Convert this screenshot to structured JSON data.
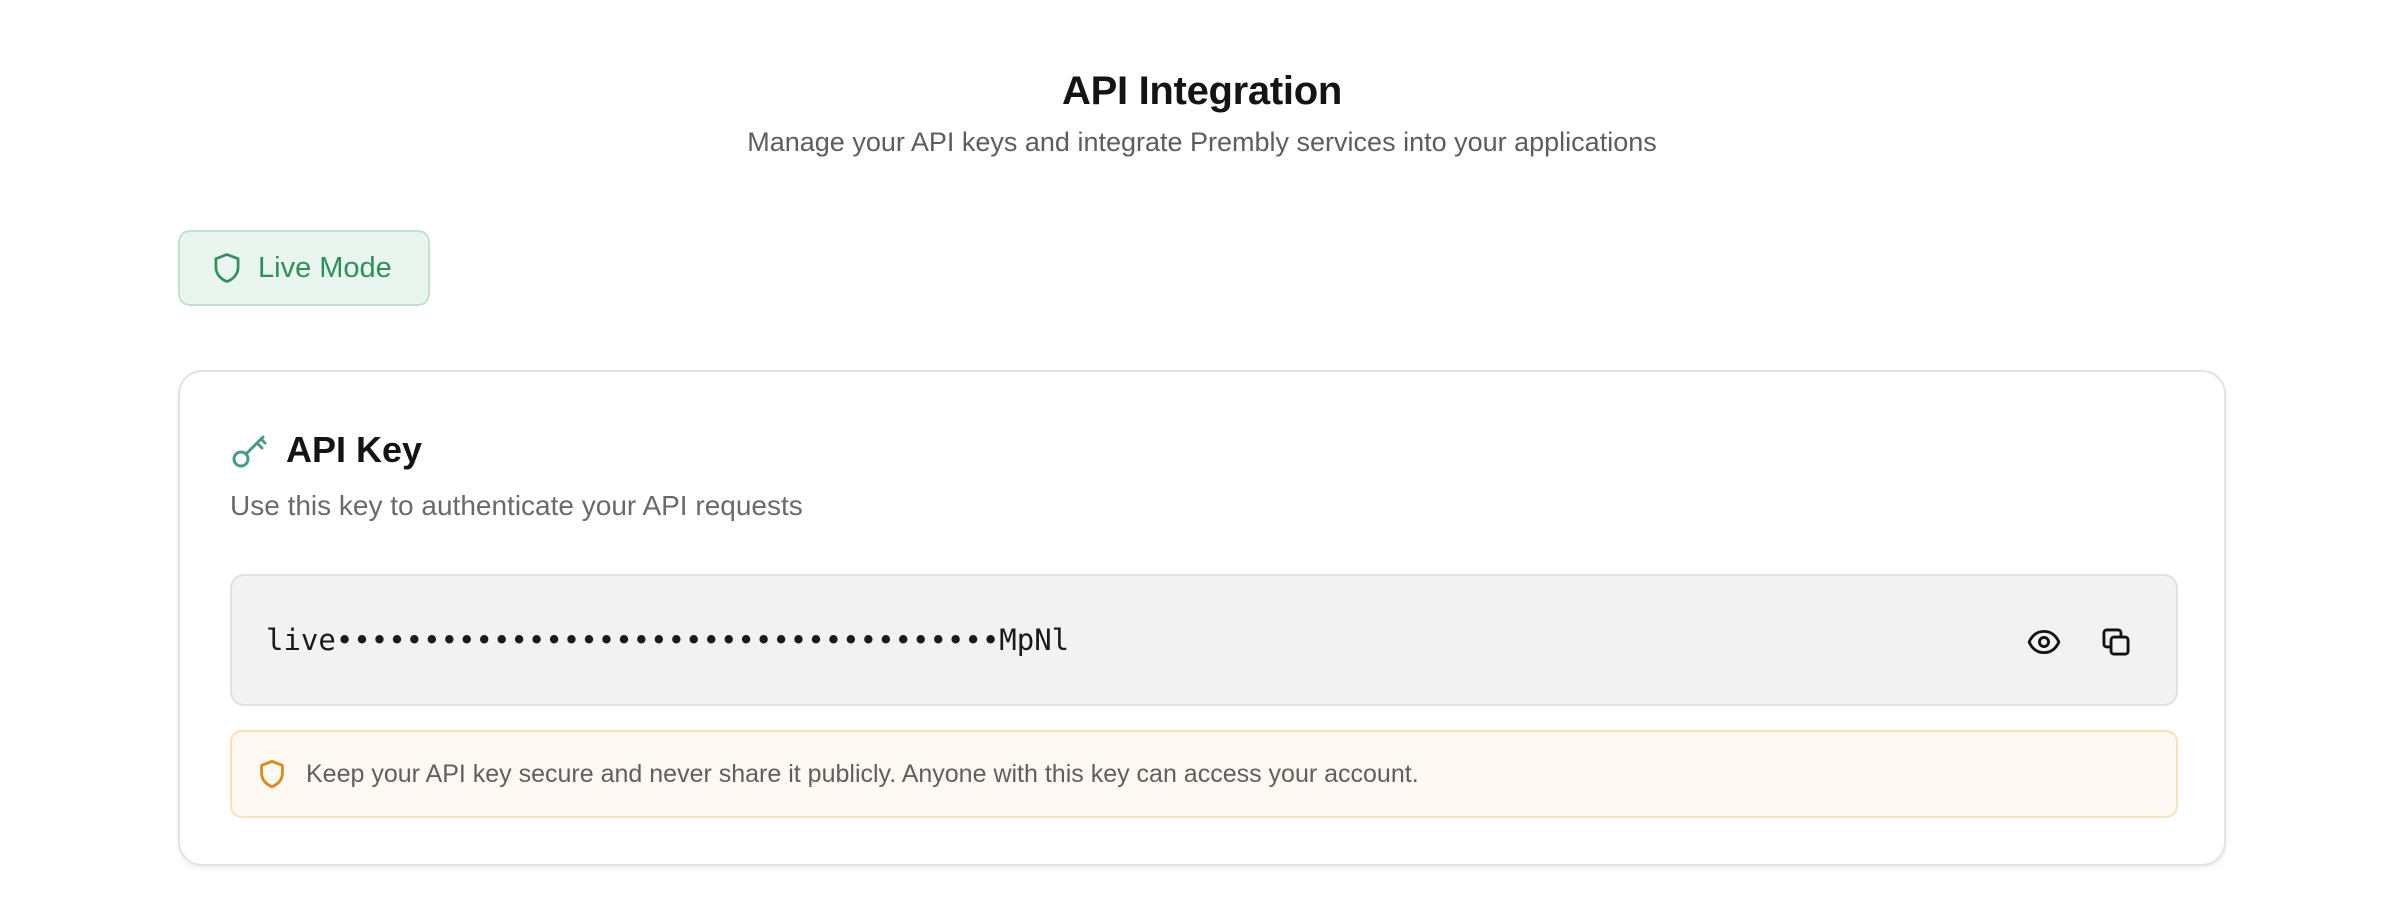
{
  "header": {
    "title": "API Integration",
    "subtitle": "Manage your API keys and integrate Prembly services into your applications"
  },
  "mode_badge": {
    "label": "Live Mode",
    "icon": "shield-icon"
  },
  "api_key_card": {
    "icon": "key-icon",
    "title": "API Key",
    "description": "Use this key to authenticate your API requests",
    "masked_key": "live••••••••••••••••••••••••••••••••••••••MpNl",
    "actions": {
      "reveal_icon": "eye-icon",
      "copy_icon": "copy-icon"
    },
    "warning": {
      "icon": "shield-icon",
      "text": "Keep your API key secure and never share it publicly. Anyone with this key can access your account."
    }
  },
  "colors": {
    "live_green": "#2f8f5b",
    "live_bg": "#e9f6ef",
    "key_icon_teal": "#4a9a8a",
    "warning_amber": "#d68a1a",
    "warning_bg": "#fdf8f1"
  }
}
